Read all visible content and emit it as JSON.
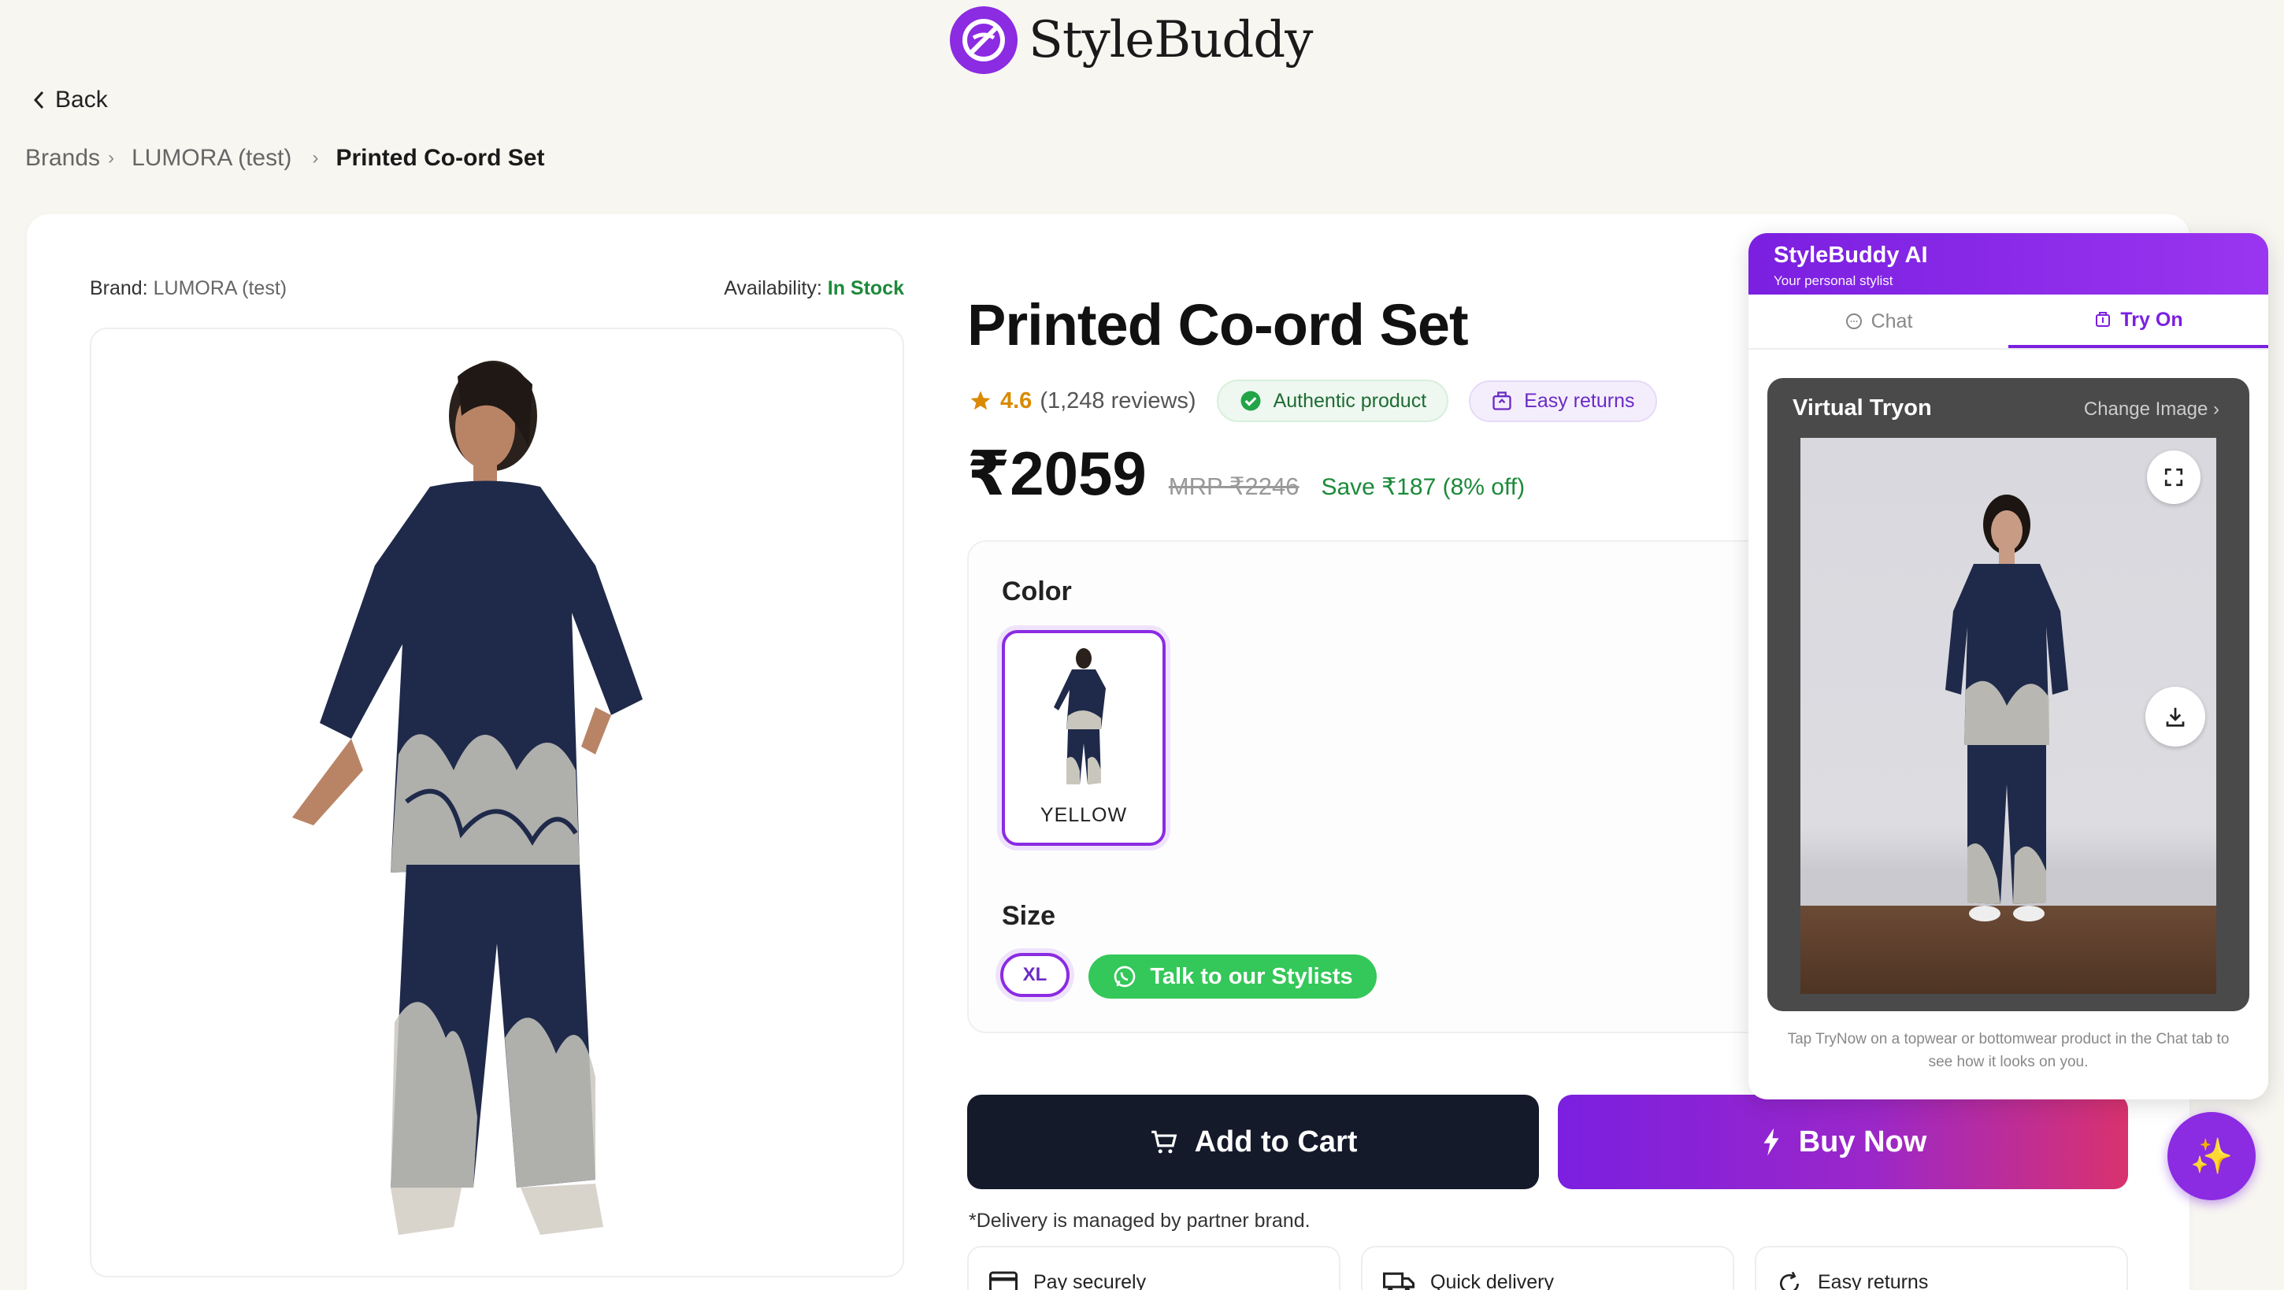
{
  "brand_logo": {
    "text": "StyleBuddy",
    "color": "#8b2be2"
  },
  "nav": {
    "back_label": "Back"
  },
  "breadcrumb": {
    "items": [
      "Brands",
      "LUMORA (test)",
      "Printed Co-ord Set"
    ]
  },
  "product": {
    "brand_label": "Brand:",
    "brand_value": "LUMORA (test)",
    "availability_label": "Availability:",
    "availability_value": "In Stock",
    "title": "Printed Co-ord Set",
    "rating": "4.6",
    "reviews": "(1,248 reviews)",
    "badge_authentic": "Authentic product",
    "badge_returns": "Easy returns",
    "price": "₹2059",
    "mrp": "MRP ₹2246",
    "savings": "Save ₹187 (8% off)",
    "color_heading": "Color",
    "color_option": "YELLOW",
    "size_heading": "Size",
    "size_option": "XL",
    "stylist_button": "Talk to our Stylists",
    "add_to_cart": "Add to Cart",
    "buy_now": "Buy Now",
    "delivery_note": "*Delivery is managed by partner brand.",
    "features": [
      "Pay securely",
      "Quick delivery",
      "Easy returns"
    ]
  },
  "ai_panel": {
    "title": "StyleBuddy AI",
    "subtitle": "Your personal stylist",
    "tabs": [
      {
        "label": "Chat",
        "active": false
      },
      {
        "label": "Try On",
        "active": true
      }
    ],
    "tryon_title": "Virtual Tryon",
    "change_image": "Change Image",
    "footer_text": "Tap TryNow on a topwear or bottomwear product in the Chat tab to see how it looks on you."
  },
  "colors": {
    "accent": "#8b2be2",
    "success": "#1d8a3a",
    "whatsapp": "#34c759",
    "dark_button": "#141a2a",
    "rating_star": "#d98a00"
  }
}
